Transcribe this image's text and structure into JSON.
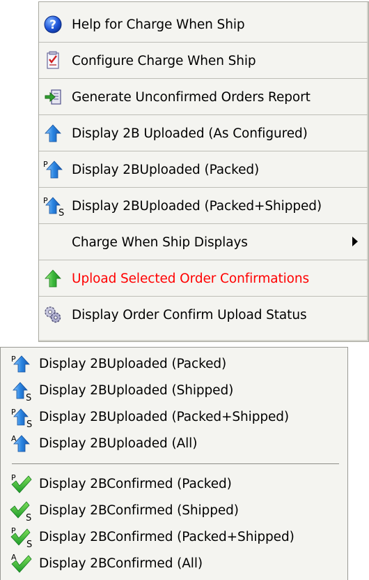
{
  "menu_top": {
    "items": [
      {
        "label": "Help for Charge When Ship",
        "icon": "help-icon"
      },
      {
        "label": "Configure Charge When Ship",
        "icon": "configure-checklist-icon"
      },
      {
        "label": "Generate Unconfirmed Orders Report",
        "icon": "report-icon"
      },
      {
        "label": "Display 2B Uploaded (As Configured)",
        "icon": "upload-arrow-icon"
      },
      {
        "label": "Display 2BUploaded (Packed)",
        "icon": "upload-arrow-packed-icon"
      },
      {
        "label": "Display 2BUploaded (Packed+Shipped)",
        "icon": "upload-arrow-packed-shipped-icon"
      },
      {
        "label": "Charge When Ship Displays",
        "icon": "submenu-arrow-icon"
      },
      {
        "label": "Upload Selected Order Confirmations",
        "icon": "green-upload-arrow-icon",
        "color": "#ff0000"
      },
      {
        "label": "Display Order Confirm Upload Status",
        "icon": "status-gears-icon"
      }
    ]
  },
  "menu_sub": {
    "items": [
      {
        "label": "Display 2BUploaded (Packed)",
        "icon": "upload-arrow-packed-icon"
      },
      {
        "label": "Display 2BUploaded (Shipped)",
        "icon": "upload-arrow-shipped-icon"
      },
      {
        "label": "Display 2BUploaded (Packed+Shipped)",
        "icon": "upload-arrow-packed-shipped-icon"
      },
      {
        "label": "Display 2BUploaded (All)",
        "icon": "upload-arrow-all-icon"
      },
      {
        "label": "Display 2BConfirmed (Packed)",
        "icon": "checkmark-packed-icon"
      },
      {
        "label": "Display 2BConfirmed (Shipped)",
        "icon": "checkmark-shipped-icon"
      },
      {
        "label": "Display 2BConfirmed (Packed+Shipped)",
        "icon": "checkmark-packed-shipped-icon"
      },
      {
        "label": "Display 2BConfirmed (All)",
        "icon": "checkmark-all-icon"
      }
    ]
  },
  "colors": {
    "menu_background": "#f4f4f0",
    "upload_arrow_blue": "#2a7fd4",
    "upload_arrow_green": "#3cb83c",
    "highlight_text": "#ff0000"
  }
}
